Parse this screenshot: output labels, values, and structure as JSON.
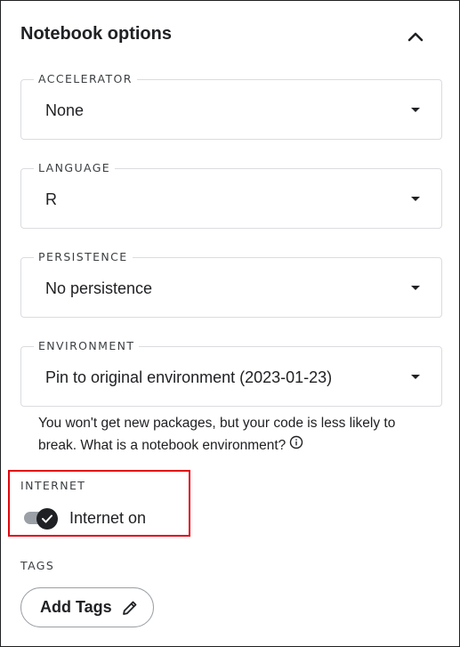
{
  "header": {
    "title": "Notebook options"
  },
  "fields": [
    {
      "label": "ACCELERATOR",
      "value": "None"
    },
    {
      "label": "LANGUAGE",
      "value": "R"
    },
    {
      "label": "PERSISTENCE",
      "value": "No persistence"
    },
    {
      "label": "ENVIRONMENT",
      "value": "Pin to original environment (2023-01-23)"
    }
  ],
  "environment_help": {
    "text": "You won't get new packages, but your code is less likely to break. What is a notebook environment?",
    "info_icon": "info-icon"
  },
  "internet": {
    "label": "INTERNET",
    "toggle_label": "Internet on",
    "enabled": true
  },
  "tags": {
    "label": "TAGS",
    "button_label": "Add Tags",
    "button_icon": "pencil-icon"
  },
  "colors": {
    "highlight_border": "#e2000f",
    "text": "#202124",
    "border": "#dadce0"
  }
}
